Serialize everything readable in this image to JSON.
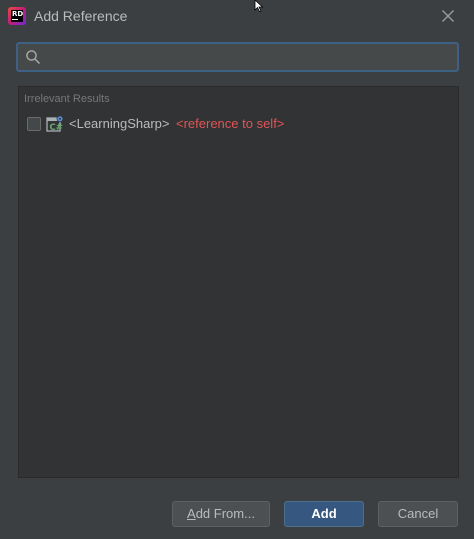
{
  "window": {
    "title": "Add Reference",
    "app_icon_text": "RD"
  },
  "search": {
    "value": "",
    "placeholder": ""
  },
  "results": {
    "group_label": "Irrelevant Results",
    "items": [
      {
        "name": "<LearningSharp>",
        "note": "<reference to self>",
        "checked": false,
        "icon": "csharp-project-icon"
      }
    ]
  },
  "buttons": {
    "add_from_mnemonic": "A",
    "add_from_rest": "dd From...",
    "add_label": "Add",
    "cancel_label": "Cancel"
  },
  "colors": {
    "background": "#3c3f41",
    "list_background": "#313335",
    "search_border": "#3d6185",
    "primary_button": "#365880",
    "self_reference_text": "#e05555",
    "text": "#bbbbbb"
  }
}
